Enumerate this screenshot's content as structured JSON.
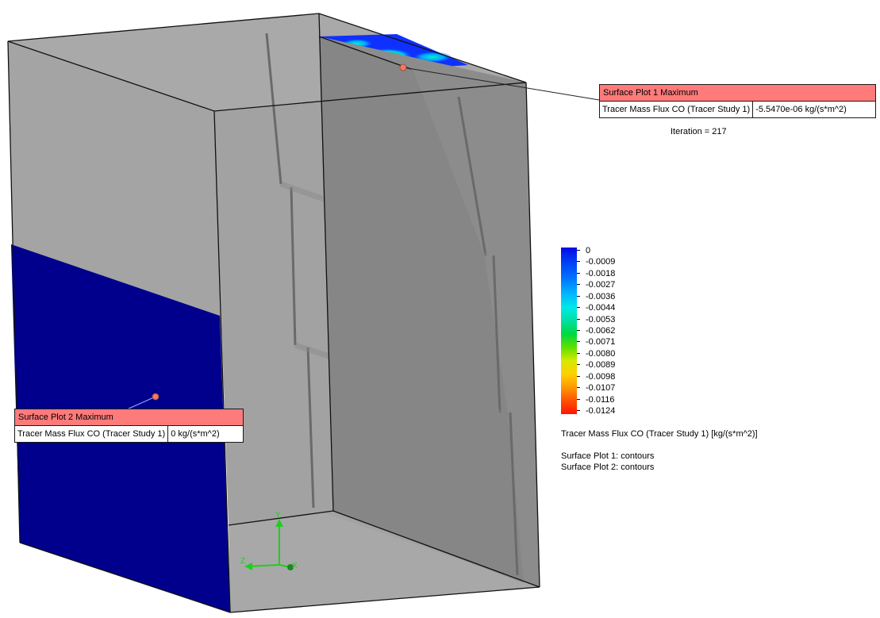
{
  "probe_1": {
    "title": "Surface Plot 1 Maximum",
    "quantity": "Tracer Mass Flux CO (Tracer Study 1)",
    "value": "-5.5470e-06 kg/(s*m^2)"
  },
  "probe_2": {
    "title": "Surface Plot 2 Maximum",
    "quantity": "Tracer Mass Flux CO (Tracer Study 1)",
    "value": "0 kg/(s*m^2)"
  },
  "iteration": "Iteration = 217",
  "legend": {
    "ticks": [
      "0",
      "-0.0009",
      "-0.0018",
      "-0.0027",
      "-0.0036",
      "-0.0044",
      "-0.0053",
      "-0.0062",
      "-0.0071",
      "-0.0080",
      "-0.0089",
      "-0.0098",
      "-0.0107",
      "-0.0116",
      "-0.0124"
    ],
    "title": "Tracer Mass Flux CO (Tracer Study 1) [kg/(s*m^2)]",
    "plot_1": "Surface Plot 1: contours",
    "plot_2": "Surface Plot 2: contours"
  },
  "axes": {
    "y": "Y",
    "z": "Z",
    "x": "X"
  },
  "colors": {
    "probe_header": "#ff7b7b",
    "box_face": "#a8a8a8",
    "interior_panel": "#8e8e8e",
    "outlet_face": "#00008c",
    "axis_triad": "#1fce1f"
  }
}
